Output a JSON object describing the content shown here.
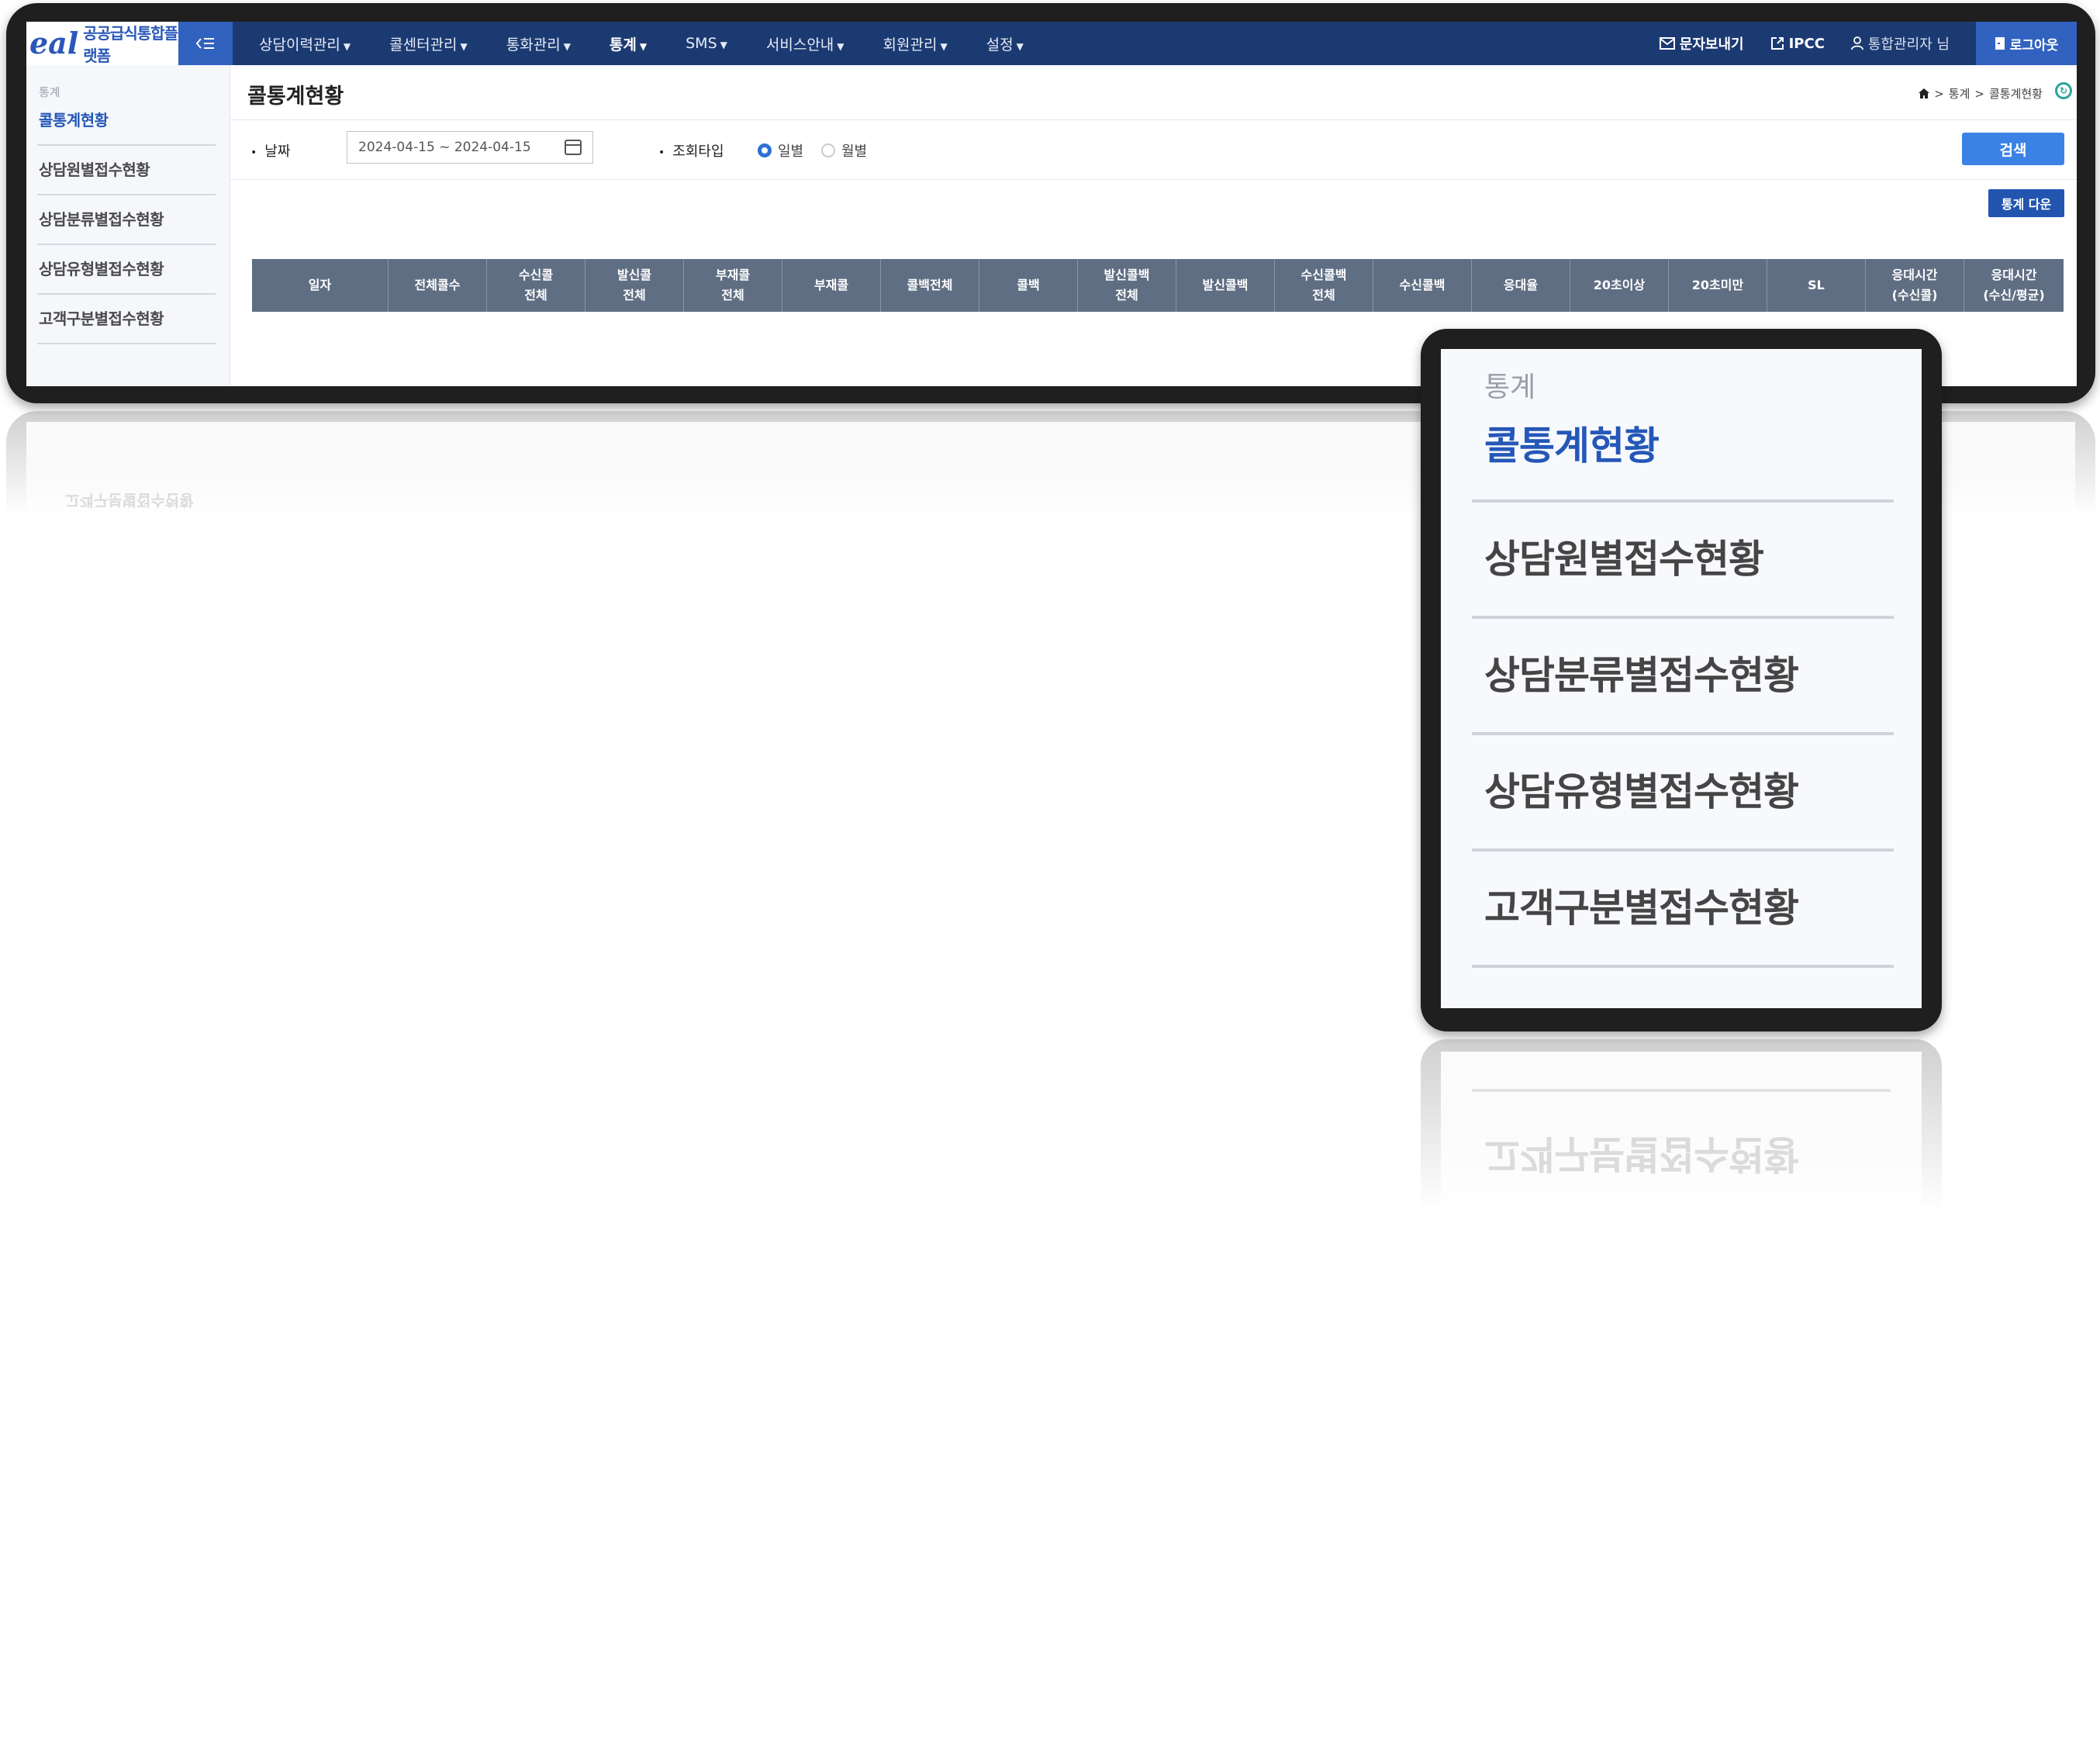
{
  "topnav": {
    "logo_mark": "eal",
    "logo_text": "공공급식통합플랫폼",
    "menu_toggle_icon": "menu-collapse-icon",
    "items": [
      {
        "label": "상담이력관리",
        "active": false
      },
      {
        "label": "콜센터관리",
        "active": false
      },
      {
        "label": "통화관리",
        "active": false
      },
      {
        "label": "통계",
        "active": true
      },
      {
        "label": "SMS",
        "active": false
      },
      {
        "label": "서비스안내",
        "active": false
      },
      {
        "label": "회원관리",
        "active": false
      },
      {
        "label": "설정",
        "active": false
      }
    ],
    "send_message": "문자보내기",
    "ipcc": "IPCC",
    "user": "통합관리자 님",
    "logout": "로그아웃"
  },
  "sidebar": {
    "header": "통계",
    "items": [
      {
        "label": "콜통계현황",
        "active": true
      },
      {
        "label": "상담원별접수현황",
        "active": false
      },
      {
        "label": "상담분류별접수현황",
        "active": false
      },
      {
        "label": "상담유형별접수현황",
        "active": false
      },
      {
        "label": "고객구분별접수현황",
        "active": false
      }
    ]
  },
  "page": {
    "title": "콜통계현황",
    "breadcrumb": [
      "통계",
      "콜통계현황"
    ]
  },
  "search": {
    "date_label": "날짜",
    "date_value": "2024-04-15 ~ 2024-04-15",
    "type_label": "조회타입",
    "options": [
      {
        "label": "일별",
        "checked": true
      },
      {
        "label": "월별",
        "checked": false
      }
    ],
    "search_button": "검색"
  },
  "download_button": "통계 다운",
  "table": {
    "columns": [
      "일자",
      "전체콜수",
      "수신콜\n전체",
      "발신콜\n전체",
      "부재콜\n전체",
      "부재콜",
      "콜백전체",
      "콜백",
      "발신콜백\n전체",
      "발신콜백",
      "수신콜백\n전체",
      "수신콜백",
      "응대율",
      "20초이상",
      "20초미만",
      "SL",
      "응대시간\n(수신콜)",
      "응대시간\n(수신/평균)"
    ],
    "rows": []
  },
  "zoom": {
    "header": "통계",
    "items": [
      {
        "label": "콜통계현황",
        "active": true
      },
      {
        "label": "상담원별접수현황",
        "active": false
      },
      {
        "label": "상담분류별접수현황",
        "active": false
      },
      {
        "label": "상담유형별접수현황",
        "active": false
      },
      {
        "label": "고객구분별접수현황",
        "active": false
      }
    ]
  },
  "colors": {
    "nav_bg": "#1c3a72",
    "accent": "#3162bf",
    "active_text": "#2457b8",
    "table_header": "#5f6e83",
    "search_button": "#3b82e6"
  }
}
